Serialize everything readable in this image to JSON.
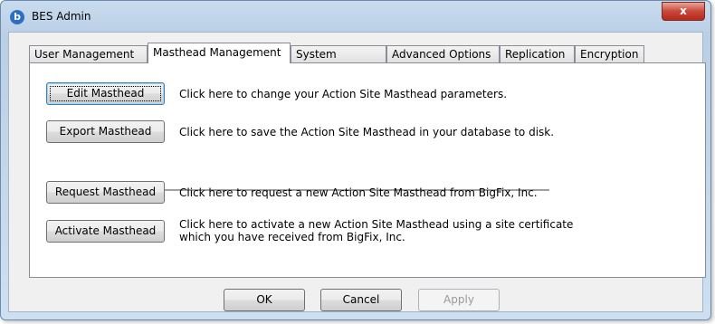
{
  "window": {
    "title": "BES Admin",
    "close_glyph": "x",
    "app_icon_glyph": "b"
  },
  "tabs": [
    {
      "label": "User Management"
    },
    {
      "label": "Masthead Management"
    },
    {
      "label": "System Options"
    },
    {
      "label": "Advanced Options"
    },
    {
      "label": "Replication"
    },
    {
      "label": "Encryption"
    }
  ],
  "active_tab": "Masthead Management",
  "actions": [
    {
      "button": "Edit Masthead",
      "description": "Click here to change your Action Site Masthead parameters."
    },
    {
      "button": "Export Masthead",
      "description": "Click here to save the Action Site Masthead in your database to disk."
    },
    {
      "button": "Request Masthead",
      "description": "Click here to request a new Action Site Masthead from BigFix, Inc."
    },
    {
      "button": "Activate Masthead",
      "description_line1": "Click here to activate a new Action Site Masthead using a site certificate",
      "description_line2": "which you have received from BigFix, Inc."
    }
  ],
  "footer": {
    "ok_label": "OK",
    "cancel_label": "Cancel",
    "apply_label": "Apply"
  },
  "colors": {
    "focus_border": "#3c7fb1",
    "close_button": "#c9473a",
    "window_frame": "#b9cfe6"
  }
}
